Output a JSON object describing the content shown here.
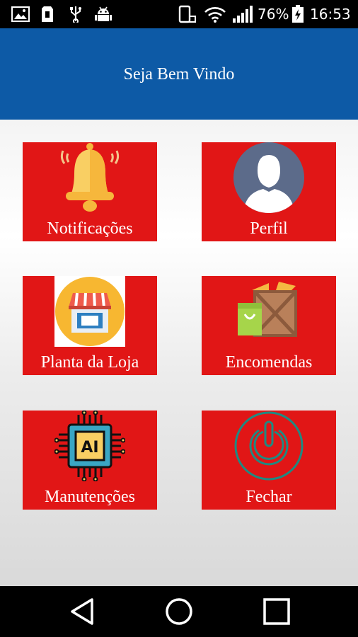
{
  "status_bar": {
    "battery_percent": "76%",
    "time": "16:53",
    "icons": [
      "image-icon",
      "sd-card-icon",
      "usb-icon",
      "android-debug-icon",
      "rotation-lock-icon",
      "wifi-icon",
      "signal-icon",
      "battery-charging-icon"
    ]
  },
  "header": {
    "title": "Seja Bem Vindo",
    "background": "#0d5aa6"
  },
  "tiles": [
    {
      "label": "Notificações",
      "icon": "bell-icon"
    },
    {
      "label": "Perfil",
      "icon": "user-avatar-icon"
    },
    {
      "label": "Planta da Loja",
      "icon": "store-icon"
    },
    {
      "label": "Encomendas",
      "icon": "boxes-icon"
    },
    {
      "label": "Manutenções",
      "icon": "ai-chip-icon"
    },
    {
      "label": "Fechar",
      "icon": "power-icon"
    }
  ],
  "colors": {
    "tile": "#e11616",
    "statusbar": "#000000",
    "navbar": "#000000"
  },
  "nav_bar": {
    "buttons": [
      "back-icon",
      "home-icon",
      "recents-icon"
    ]
  }
}
